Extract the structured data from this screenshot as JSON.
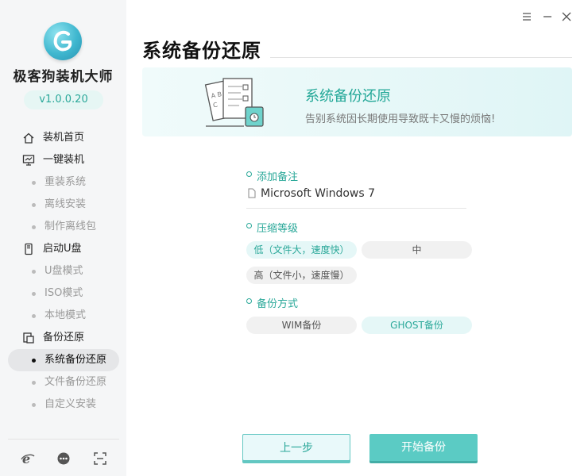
{
  "app": {
    "name": "极客狗装机大师",
    "version": "v1.0.0.20"
  },
  "sidebar": {
    "items": [
      {
        "label": "装机首页",
        "type": "main",
        "icon": "home-icon"
      },
      {
        "label": "一键装机",
        "type": "main",
        "icon": "monitor-icon"
      },
      {
        "label": "重装系统",
        "type": "sub"
      },
      {
        "label": "离线安装",
        "type": "sub"
      },
      {
        "label": "制作离线包",
        "type": "sub"
      },
      {
        "label": "启动U盘",
        "type": "main",
        "icon": "usb-icon"
      },
      {
        "label": "U盘模式",
        "type": "sub"
      },
      {
        "label": "ISO模式",
        "type": "sub"
      },
      {
        "label": "本地模式",
        "type": "sub"
      },
      {
        "label": "备份还原",
        "type": "main",
        "icon": "backup-icon"
      },
      {
        "label": "系统备份还原",
        "type": "sub",
        "active": true
      },
      {
        "label": "文件备份还原",
        "type": "sub"
      },
      {
        "label": "自定义安装",
        "type": "sub"
      }
    ],
    "footer_icons": [
      "browser-icon",
      "chat-icon",
      "fullscreen-icon"
    ]
  },
  "window_controls": [
    "menu-icon",
    "minimize-icon",
    "close-icon"
  ],
  "page": {
    "title": "系统备份还原"
  },
  "banner": {
    "title": "系统备份还原",
    "subtitle": "告别系统因长期使用导致既卡又慢的烦恼!"
  },
  "form": {
    "note_label": "添加备注",
    "note_value": "Microsoft Windows 7",
    "compression_label": "压缩等级",
    "compression_options": [
      {
        "label": "低（文件大，速度快）",
        "selected": true
      },
      {
        "label": "中",
        "selected": false
      },
      {
        "label": "高（文件小，速度慢）",
        "selected": false
      }
    ],
    "method_label": "备份方式",
    "method_options": [
      {
        "label": "WIM备份",
        "selected": false
      },
      {
        "label": "GHOST备份",
        "selected": true
      }
    ]
  },
  "buttons": {
    "prev": "上一步",
    "start": "开始备份"
  },
  "colors": {
    "accent": "#2aa899",
    "primary_button": "#5bcbc4",
    "sidebar_bg": "#f5f6f7"
  }
}
